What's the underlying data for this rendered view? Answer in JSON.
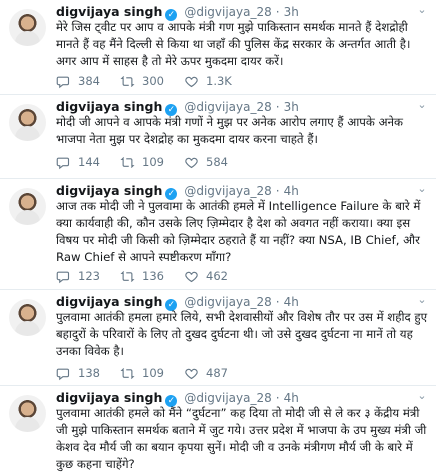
{
  "account": {
    "name": "digvijaya singh",
    "handle": "@digvijaya_28",
    "separator": "·"
  },
  "tweets": [
    {
      "time": "3h",
      "text": "मेरे जिस ट्वीट पर आप व आपके मंत्री गण मुझे पाकिस्तान समर्थक मानते हैं देशद्रोही मानते हैं वह मैंने दिल्ली से किया था जहाँ की पुलिस केंद्र सरकार के अन्तर्गत आती है। अगर आप में साहस है तो मेरे ऊपर मुकदमा दायर करें।",
      "replies": "384",
      "retweets": "300",
      "likes": "1.3K"
    },
    {
      "time": "3h",
      "text": "मोदी जी आपने व आपके मंत्री गणों ने मुझ पर अनेक आरोप लगाए हैं आपके अनेक भाजपा नेता मुझ पर देशद्रोह का मुकदमा दायर करना चाहते हैं।",
      "replies": "144",
      "retweets": "109",
      "likes": "584"
    },
    {
      "time": "4h",
      "text": "आज तक मोदी जी ने पुलवामा के आतंकी हमले में Intelligence Failure के बारे में क्या कार्यवाही की, कौन उसके लिए ज़िम्मेदार है देश को अवगत नहीं कराया। क्या इस विषय पर मोदी जी किसी को ज़िम्मेदार ठहराते हैं या नहीं? क्या NSA, IB Chief, और  Raw Chief से आपने स्पष्टीकरण माँगा?",
      "replies": "123",
      "retweets": "136",
      "likes": "462"
    },
    {
      "time": "4h",
      "text": "पुलवामा आतंकी हमला हमारे लिये, सभी देशवासीयों और विशेष तौर पर उस में शहीद हुए बहादुरों के परिवारों के लिए तो दुखद दुर्घटना थी। जो उसे दुखद दुर्घटना ना मानें तो यह उनका विवेक है।",
      "replies": "138",
      "retweets": "109",
      "likes": "487"
    },
    {
      "time": "4h",
      "text": "पुलवामा आतंकी हमले को मैंने “दुर्घटना” कह दिया तो मोदी जी से ले कर ३ केंद्रीय मंत्री जी मुझे पाकिस्तान समर्थक बताने में जुट गये।  उत्तर प्रदेश में भाजपा के उप मुख्य मंत्री जी केशव देव मौर्य जी का बयान कृपया सुनें। मोदी जी व उनके मंत्रीगण मौर्य जी के बारे में कुछ कहना चाहेंगे?",
      "replies": "",
      "retweets": "",
      "likes": ""
    }
  ],
  "icons": {
    "reply": "reply-icon",
    "retweet": "retweet-icon",
    "like": "like-icon",
    "menu": "chevron-down-icon",
    "verified": "verified-badge-icon"
  },
  "colors": {
    "text": "#14171a",
    "secondary": "#657786",
    "verified": "#1da1f2",
    "divider": "#e6ecf0"
  }
}
